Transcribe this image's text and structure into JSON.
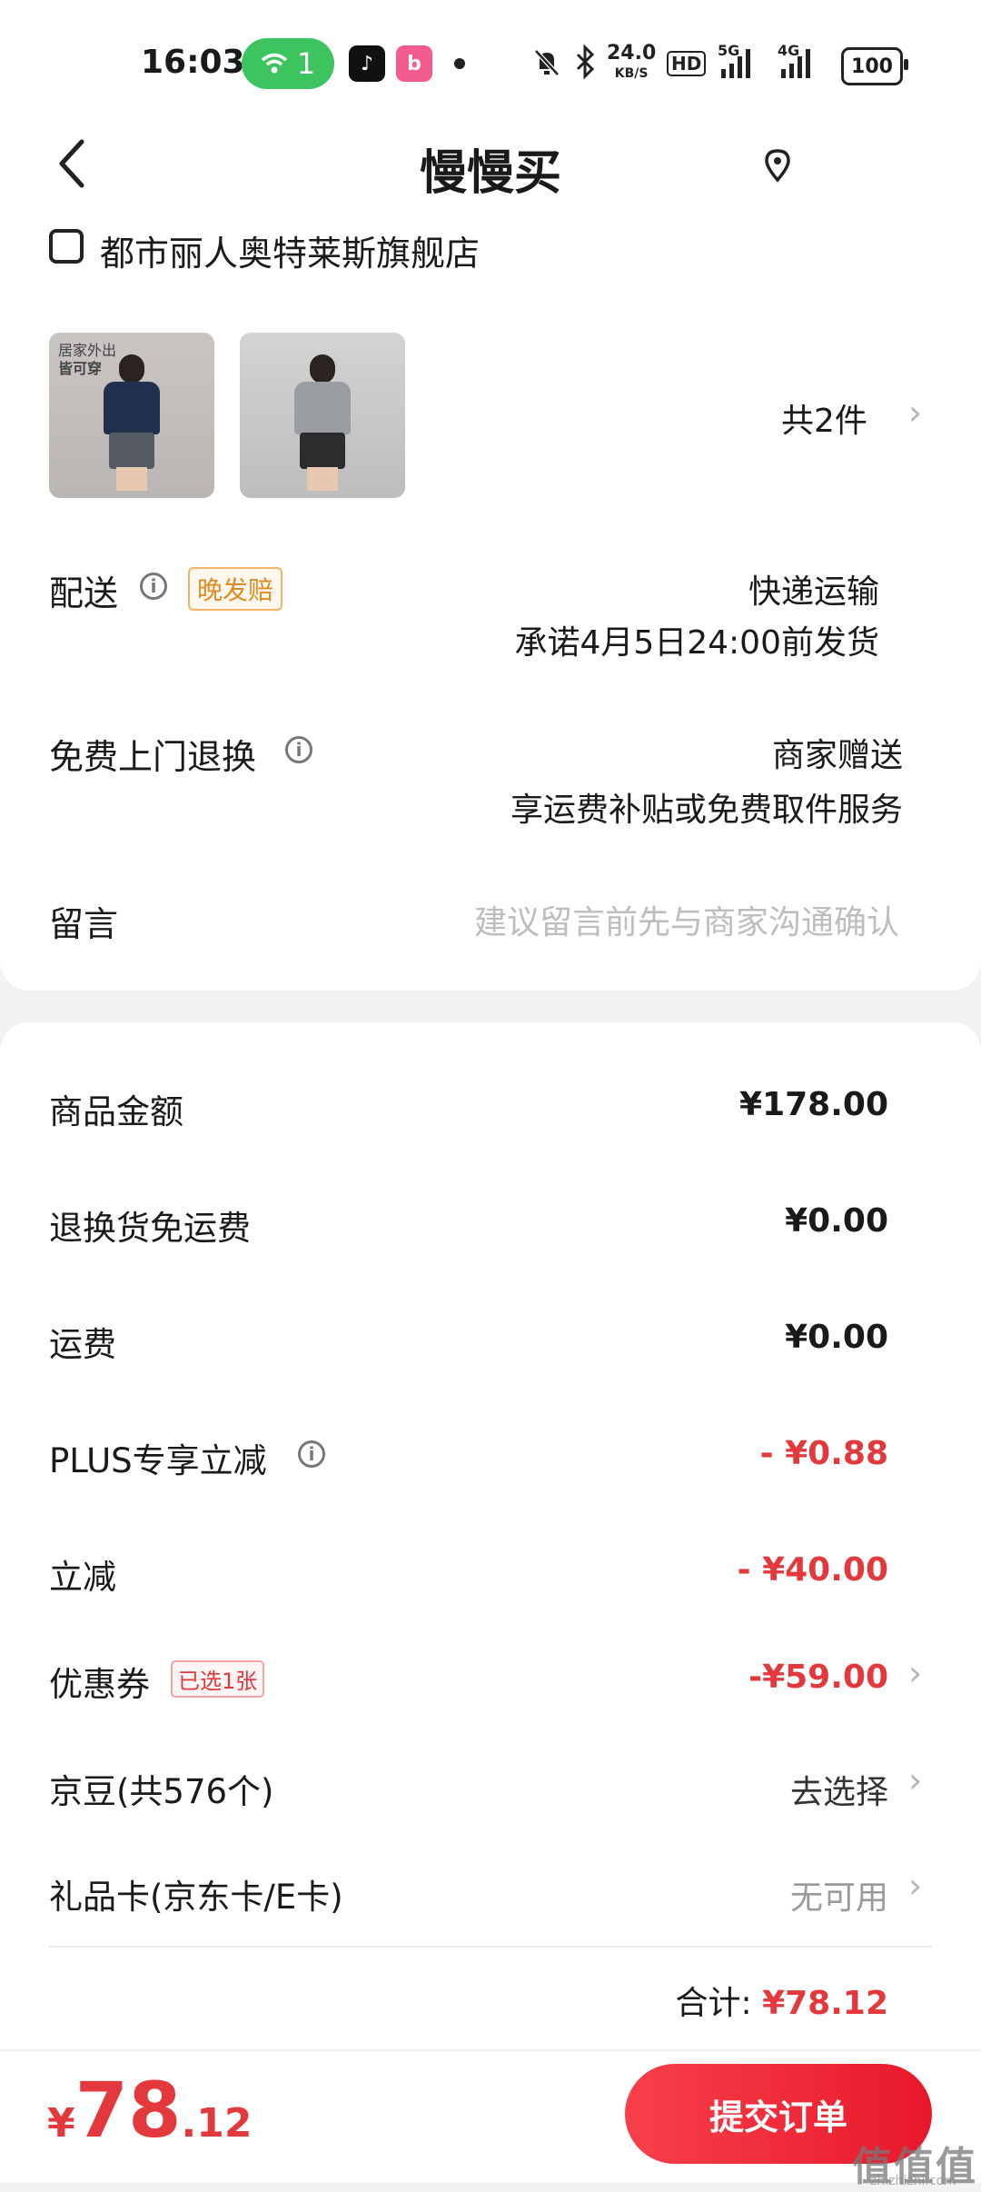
{
  "status_bar": {
    "time": "16:03",
    "wifi_badge": "1",
    "network_speed": "24.0",
    "network_speed_unit": "KB/S",
    "hd_label": "HD",
    "signal1": "5G",
    "signal2": "4G",
    "battery": "100"
  },
  "header": {
    "title": "慢慢买"
  },
  "store": {
    "name": "都市丽人奥特莱斯旗舰店"
  },
  "products": {
    "thumb1_caption_line1": "居家外出",
    "thumb1_caption_line2": "皆可穿",
    "count_label": "共2件"
  },
  "delivery": {
    "label": "配送",
    "tag": "晚发赔",
    "method": "快递运输",
    "promise": "承诺4月5日24:00前发货"
  },
  "return_service": {
    "label": "免费上门退换",
    "value": "商家赠送",
    "desc": "享运费补贴或免费取件服务"
  },
  "message": {
    "label": "留言",
    "placeholder": "建议留言前先与商家沟通确认"
  },
  "pricing": {
    "goods_amount_label": "商品金额",
    "goods_amount": "¥178.00",
    "return_shipping_label": "退换货免运费",
    "return_shipping": "¥0.00",
    "shipping_label": "运费",
    "shipping": "¥0.00",
    "plus_label": "PLUS专享立减",
    "plus_discount": "- ¥0.88",
    "instant_label": "立减",
    "instant_discount": "- ¥40.00",
    "coupon_label": "优惠券",
    "coupon_tag": "已选1张",
    "coupon_discount": "-¥59.00",
    "jingdou_label": "京豆(共576个)",
    "jingdou_action": "去选择",
    "giftcard_label": "礼品卡(京东卡/E卡)",
    "giftcard_value": "无可用",
    "total_label": "合计:",
    "total_value": "¥78.12"
  },
  "bottom": {
    "currency": "¥",
    "price_int": "78",
    "price_dec": ".12",
    "submit_label": "提交订单",
    "watermark": "值值值",
    "watermark_sub": "zhizhizhi.com"
  },
  "colors": {
    "accent_red": "#e4393c",
    "tag_orange": "#e08a1f",
    "wifi_green": "#3ec45e"
  }
}
